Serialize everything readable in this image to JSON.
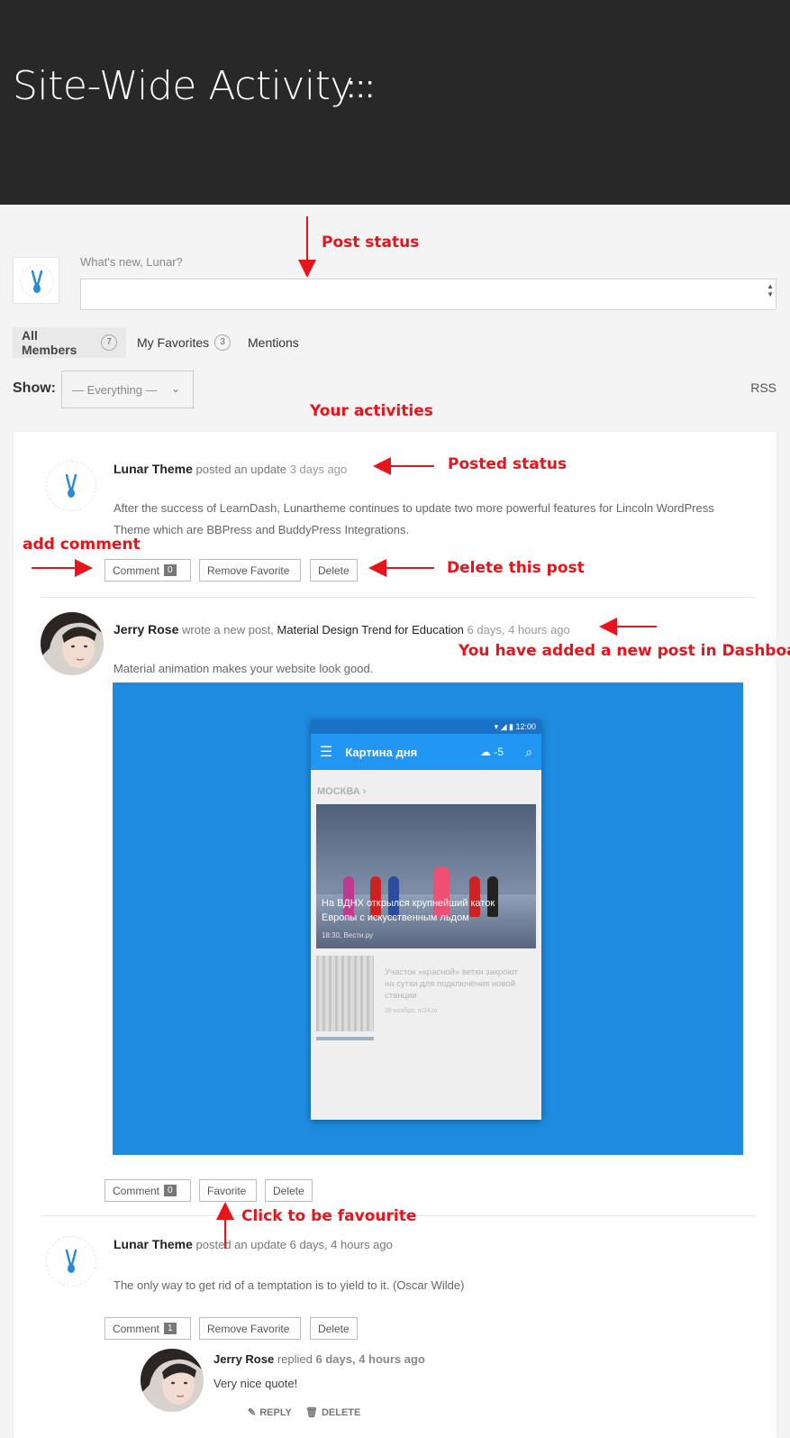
{
  "header": {
    "title": "Site-Wide Activity",
    "dots": ":::"
  },
  "annotations": {
    "post_status": "Post status",
    "your_activities": "Your activities",
    "posted_status": "Posted status",
    "add_comment": "add comment",
    "delete_post": "Delete this post",
    "new_post": "You have added a new post in Dashboard",
    "favourite": "Click to be favourite"
  },
  "form": {
    "prompt": "What's new, Lunar?",
    "textarea_value": ""
  },
  "tabs": [
    {
      "label": "All Members",
      "count": "7"
    },
    {
      "label": "My Favorites",
      "count": "3"
    },
    {
      "label": "Mentions"
    }
  ],
  "filter": {
    "label": "Show:",
    "selected": "— Everything —",
    "rss": "RSS"
  },
  "activities": [
    {
      "user": "Lunar Theme",
      "action": "posted an update",
      "time": "3 days ago",
      "content": "After the success of LearnDash, Lunartheme continues to update two more powerful features for Lincoln WordPress Theme which are BBPress and BuddyPress Integrations.",
      "buttons": {
        "comment": "Comment",
        "comment_count": "0",
        "favorite": "Remove Favorite",
        "delete": "Delete"
      }
    },
    {
      "user": "Jerry Rose",
      "action": "wrote a new post,",
      "post_title": "Material Design Trend for Education",
      "time": "6 days, 4 hours ago",
      "content": "Material animation makes your website look good.",
      "buttons": {
        "comment": "Comment",
        "comment_count": "0",
        "favorite": "Favorite",
        "delete": "Delete"
      },
      "media": {
        "status_time": "12:00",
        "app_title": "Картина дня",
        "weather": "-5",
        "city": "МОСКВА",
        "headline": "На ВДНХ открылся крупнейший каток Европы с искусственным льдом",
        "headline_source": "18:30, Вести.ру",
        "second_title": "Участок «красной» ветки закроют на сутки для подключения новой станции",
        "second_source": "28 ноября, m24.ru"
      }
    },
    {
      "user": "Lunar Theme",
      "action": "posted an update",
      "time": "6 days, 4 hours ago",
      "content": "The only way to get rid of a temptation is to yield to it. (Oscar Wilde)",
      "buttons": {
        "comment": "Comment",
        "comment_count": "1",
        "favorite": "Remove Favorite",
        "delete": "Delete"
      },
      "reply": {
        "user": "Jerry Rose",
        "action": "replied",
        "time": "6 days, 4 hours ago",
        "content": "Very nice quote!",
        "reply_label": "REPLY",
        "delete_label": "DELETE"
      }
    }
  ],
  "colors": {
    "header_bg": "#282828",
    "annotation": "#e8141c",
    "media_bg": "#1e8be0"
  }
}
